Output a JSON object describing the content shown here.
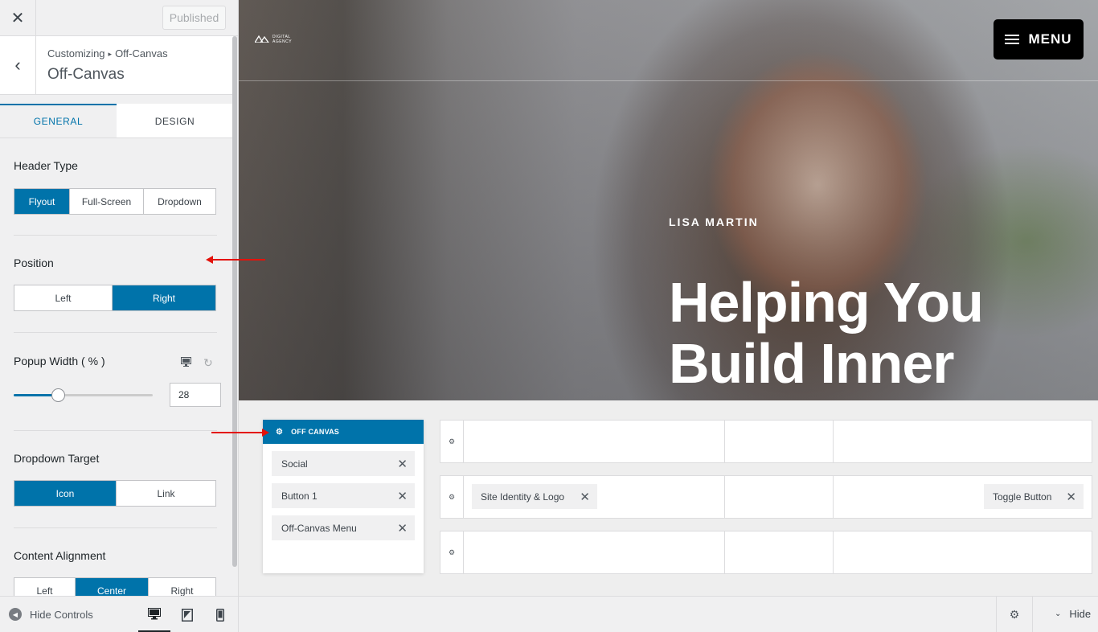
{
  "topbar": {
    "close_icon": "close-icon",
    "published_label": "Published"
  },
  "section": {
    "breadcrumb_root": "Customizing",
    "breadcrumb_sep": "▸",
    "breadcrumb_leaf": "Off-Canvas",
    "title": "Off-Canvas"
  },
  "tabs": [
    {
      "label": "General",
      "active": true
    },
    {
      "label": "Design",
      "active": false
    }
  ],
  "controls": {
    "header_type": {
      "label": "Header Type",
      "options": [
        "Flyout",
        "Full-Screen",
        "Dropdown"
      ],
      "selected": "Flyout"
    },
    "position": {
      "label": "Position",
      "options": [
        "Left",
        "Right"
      ],
      "selected": "Right"
    },
    "popup_width": {
      "label": "Popup Width ( % )",
      "value": "28",
      "slider_fraction": 0.32
    },
    "dropdown_target": {
      "label": "Dropdown Target",
      "options": [
        "Icon",
        "Link"
      ],
      "selected": "Icon"
    },
    "content_alignment": {
      "label": "Content Alignment",
      "options": [
        "Left",
        "Center",
        "Right"
      ],
      "selected": "Center"
    }
  },
  "footer": {
    "hide_controls": "Hide Controls",
    "hide": "Hide"
  },
  "hero": {
    "logo_text_line1": "DIGITAL",
    "logo_text_line2": "AGENCY",
    "menu_label": "MENU",
    "kicker": "LISA MARTIN",
    "headline_line1": "Helping You",
    "headline_line2": "Build Inner"
  },
  "builder": {
    "off_canvas_title": "OFF CANVAS",
    "off_canvas_items": [
      "Social",
      "Button 1",
      "Off-Canvas Menu"
    ],
    "row2_left_chip": "Site Identity & Logo",
    "row2_right_chip": "Toggle Button"
  },
  "colors": {
    "accent": "#0073aa",
    "arrow": "#e3120b"
  }
}
